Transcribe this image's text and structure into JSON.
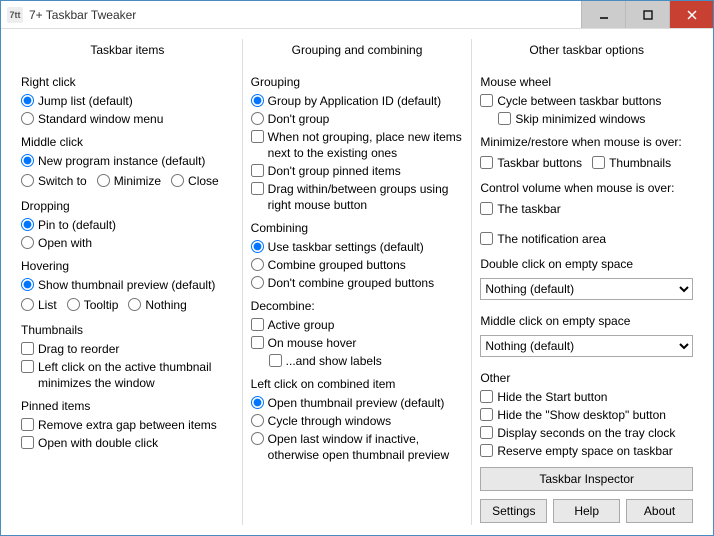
{
  "window": {
    "title": "7+ Taskbar Tweaker"
  },
  "col1": {
    "header": "Taskbar items",
    "right_click": {
      "label": "Right click",
      "jump_list": "Jump list (default)",
      "standard_menu": "Standard window menu"
    },
    "middle_click": {
      "label": "Middle click",
      "new_instance": "New program instance (default)",
      "switch_to": "Switch to",
      "minimize": "Minimize",
      "close": "Close"
    },
    "dropping": {
      "label": "Dropping",
      "pin_to": "Pin to (default)",
      "open_with": "Open with"
    },
    "hovering": {
      "label": "Hovering",
      "show_thumb": "Show thumbnail preview (default)",
      "list": "List",
      "tooltip": "Tooltip",
      "nothing": "Nothing"
    },
    "thumbnails": {
      "label": "Thumbnails",
      "drag_reorder": "Drag to reorder",
      "left_click_active": "Left click on the active thumbnail minimizes the window"
    },
    "pinned": {
      "label": "Pinned items",
      "remove_gap": "Remove extra gap between items",
      "open_dbl": "Open with double click"
    }
  },
  "col2": {
    "header": "Grouping and combining",
    "grouping": {
      "label": "Grouping",
      "by_app_id": "Group by Application ID (default)",
      "dont_group": "Don't group",
      "place_new": "When not grouping, place new items next to the existing ones",
      "dont_group_pinned": "Don't group pinned items",
      "drag_between": "Drag within/between groups using right mouse button"
    },
    "combining": {
      "label": "Combining",
      "use_settings": "Use taskbar settings (default)",
      "combine": "Combine grouped buttons",
      "dont_combine": "Don't combine grouped buttons"
    },
    "decombine": {
      "label": "Decombine:",
      "active_group": "Active group",
      "on_hover": "On mouse hover",
      "show_labels": "...and show labels"
    },
    "left_click_combined": {
      "label": "Left click on combined item",
      "open_preview": "Open thumbnail preview (default)",
      "cycle": "Cycle through windows",
      "open_last": "Open last window if inactive, otherwise open thumbnail preview"
    }
  },
  "col3": {
    "header": "Other taskbar options",
    "mouse_wheel": {
      "label": "Mouse wheel",
      "cycle_buttons": "Cycle between taskbar buttons",
      "skip_minimized": "Skip minimized windows"
    },
    "min_restore": {
      "label": "Minimize/restore when mouse is over:",
      "taskbar_buttons": "Taskbar buttons",
      "thumbnails": "Thumbnails"
    },
    "volume": {
      "label": "Control volume when mouse is over:",
      "taskbar": "The taskbar",
      "notif_area": "The notification area"
    },
    "dbl_click": {
      "label": "Double click on empty space",
      "value": "Nothing (default)"
    },
    "mid_click": {
      "label": "Middle click on empty space",
      "value": "Nothing (default)"
    },
    "other": {
      "label": "Other",
      "hide_start": "Hide the Start button",
      "hide_show_desktop": "Hide the \"Show desktop\" button",
      "display_seconds": "Display seconds on the tray clock",
      "reserve_space": "Reserve empty space on taskbar"
    },
    "buttons": {
      "inspector": "Taskbar Inspector",
      "settings": "Settings",
      "help": "Help",
      "about": "About"
    }
  }
}
